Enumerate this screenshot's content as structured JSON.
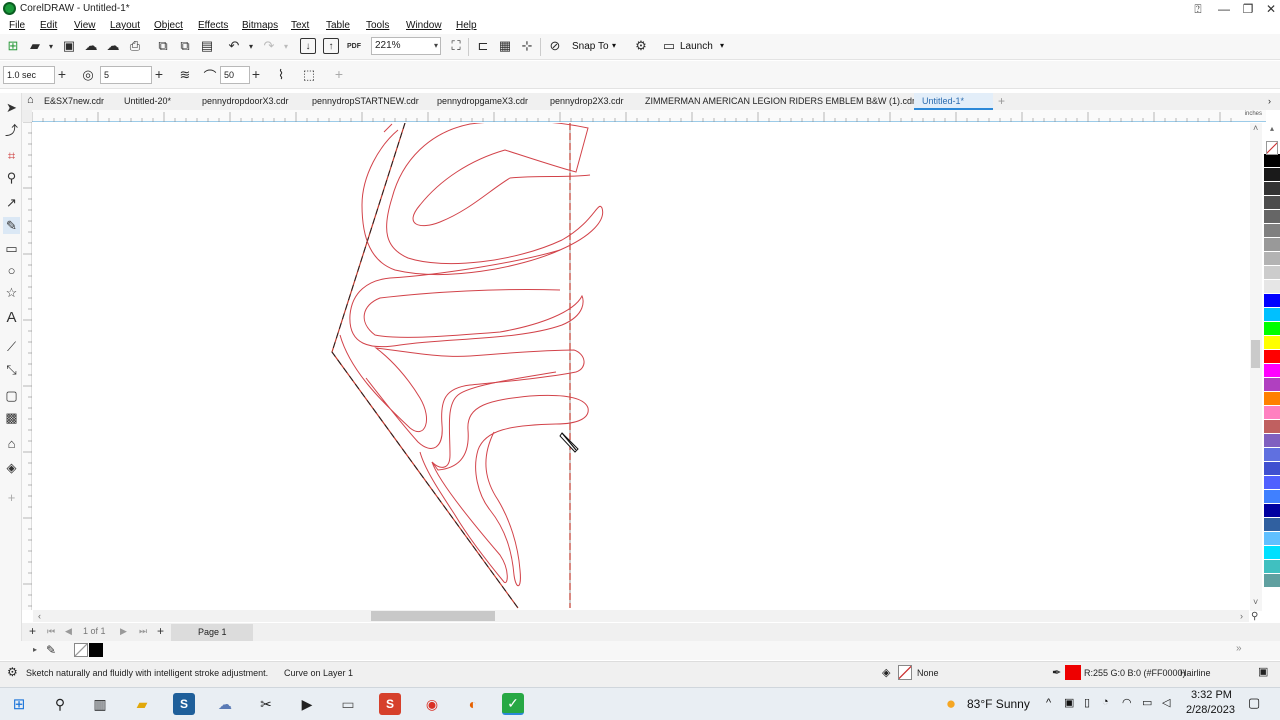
{
  "window": {
    "title": "CorelDRAW - Untitled-1*"
  },
  "menu": [
    "File",
    "Edit",
    "View",
    "Layout",
    "Object",
    "Effects",
    "Bitmaps",
    "Text",
    "Table",
    "Tools",
    "Window",
    "Help"
  ],
  "toolbar": {
    "zoom": "221%",
    "snap_to": "Snap To",
    "launch": "Launch",
    "pdf_label": "PDF"
  },
  "properties": {
    "delay": "1.0 sec",
    "freehand_smoothing": "5",
    "curve_smoothing": "50"
  },
  "doc_tabs": [
    "E&SX7new.cdr",
    "Untitled-20*",
    "pennydropdoorX3.cdr",
    "pennydropSTARTNEW.cdr",
    "pennydropgameX3.cdr",
    "pennydrop2X3.cdr",
    "ZIMMERMAN AMERICAN LEGION RIDERS EMBLEM B&W (1).cdr*",
    "Untitled-1*"
  ],
  "ruler_units": "inches",
  "page_nav": {
    "position": "1 of 1",
    "page_tab": "Page 1"
  },
  "status": {
    "hint": "Sketch naturally and fluidly with intelligent stroke adjustment.",
    "selection": "Curve on Layer 1",
    "fill": "None",
    "outline_color": "R:255 G:0 B:0 (#FF0000)",
    "outline_width": "Hairline",
    "outline_hex": "#ee0000"
  },
  "taskbar": {
    "weather": "83°F  Sunny",
    "time": "3:32 PM",
    "date": "2/28/2023"
  },
  "palette": [
    "#ffffff",
    "#000000",
    "#1a1a1a",
    "#333333",
    "#4d4d4d",
    "#666666",
    "#808080",
    "#999999",
    "#b3b3b3",
    "#cccccc",
    "#e6e6e6",
    "#0000ff",
    "#00c0ff",
    "#00ff00",
    "#ffff00",
    "#ff0000",
    "#ff00ff",
    "#b040c0",
    "#ff8000",
    "#ff80c0",
    "#c06060",
    "#8060c0",
    "#6070e0",
    "#4050d0",
    "#5060ff",
    "#4080ff",
    "#0000a0",
    "#3060a0",
    "#60c0ff",
    "#00e0ff",
    "#40c0c0",
    "#60a0a0"
  ]
}
